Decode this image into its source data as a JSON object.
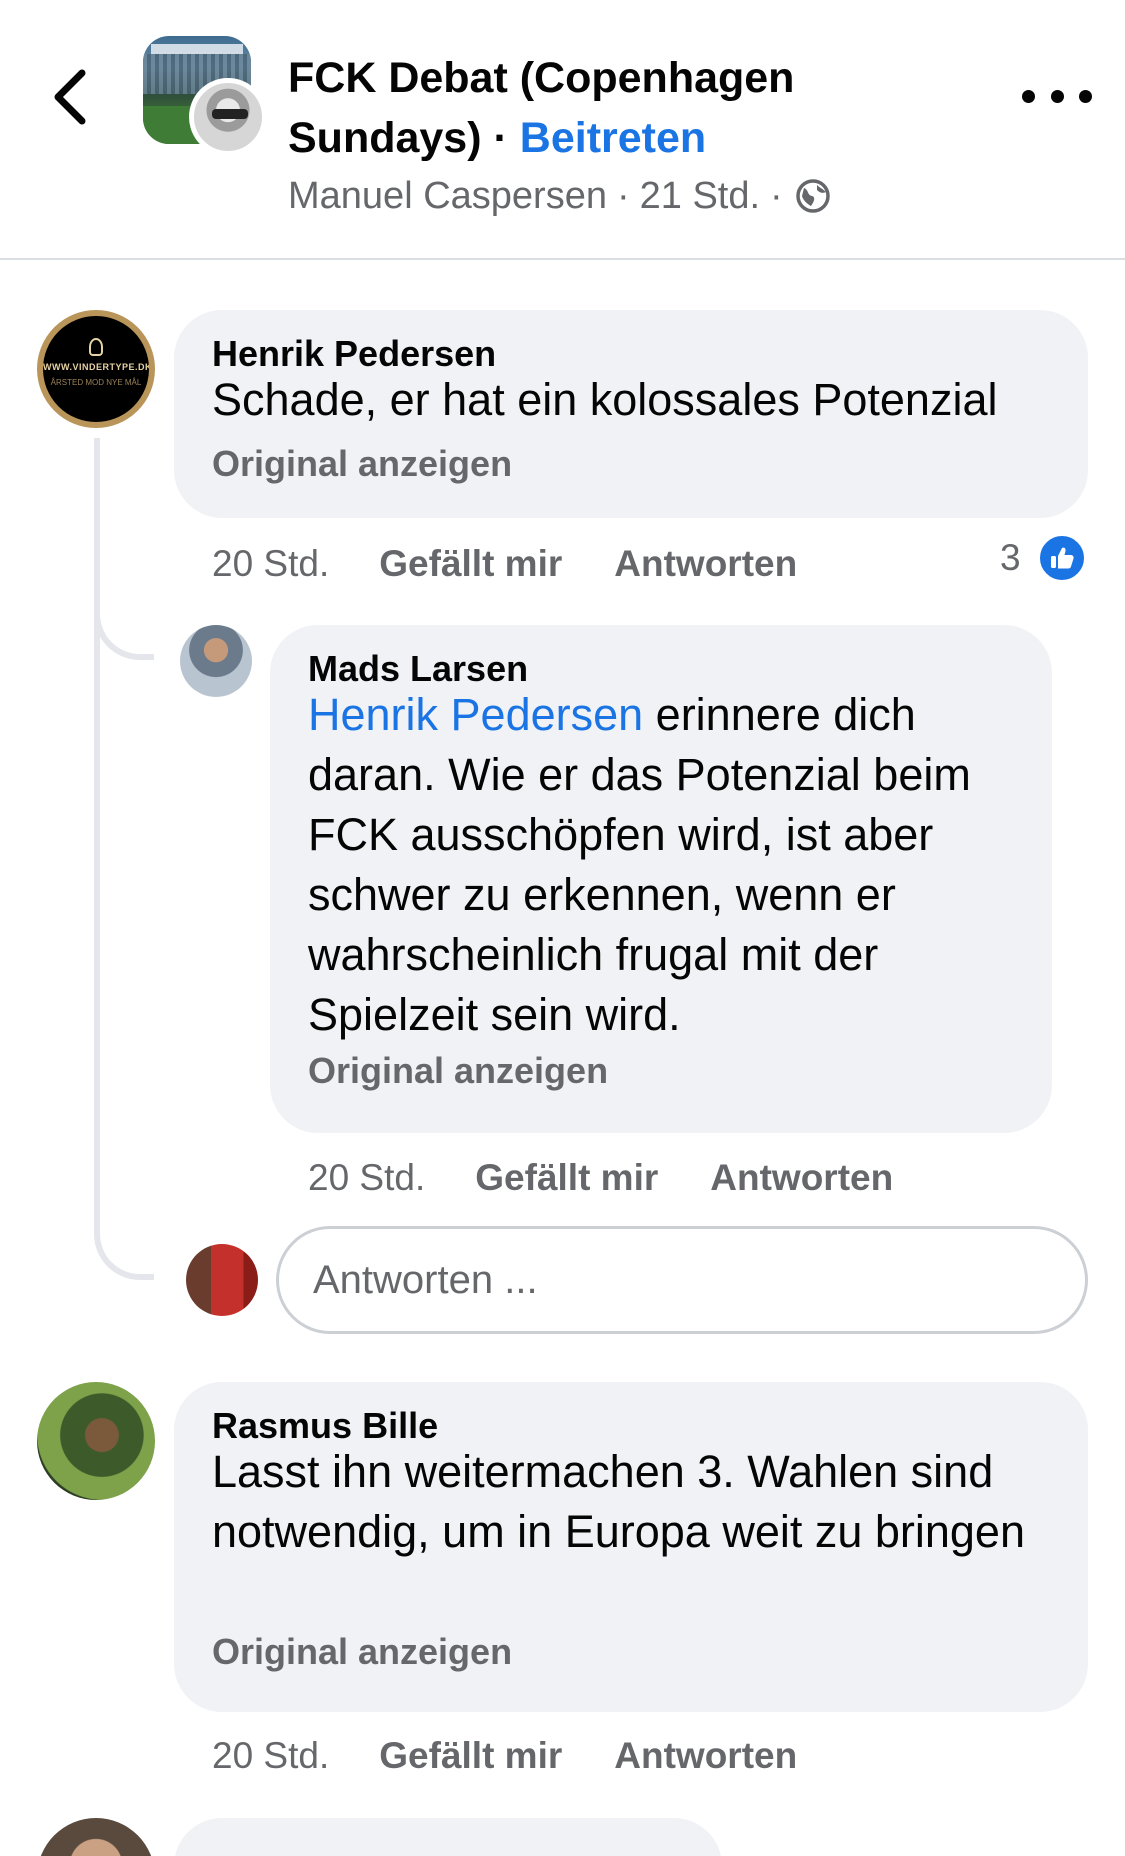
{
  "header": {
    "group_name": "FCK Debat (Copenhagen Sundays)",
    "separator": "·",
    "join_label": "Beitreten",
    "author": "Manuel Caspersen",
    "time": "21 Std.",
    "sub_separator": "·",
    "icons": {
      "back": "chevron-left-icon",
      "more": "more-dots-icon",
      "privacy": "globe-icon"
    }
  },
  "comments": [
    {
      "name": "Henrik Pedersen",
      "text": "Schade, er hat ein kolossales Potenzial",
      "translate": "Original anzeigen",
      "time": "20 Std.",
      "like": "Gefällt mir",
      "reply": "Antworten",
      "reactions": "3",
      "avatar_text": "WWW.VINDERTYPE.DK",
      "avatar_sub": "ÅRSTED MOD NYE MÅL"
    },
    {
      "name": "Mads Larsen",
      "mention": "Henrik Pedersen",
      "text": " erinnere dich daran. Wie er das Potenzial beim FCK ausschöpfen wird, ist aber schwer zu erkennen, wenn er wahrscheinlich frugal mit der Spielzeit sein wird.",
      "translate": "Original anzeigen",
      "time": "20 Std.",
      "like": "Gefällt mir",
      "reply": "Antworten"
    },
    {
      "name": "Rasmus Bille",
      "text": "Lasst ihn weitermachen 3. Wahlen sind notwendig, um in Europa weit zu bringen",
      "translate": "Original anzeigen",
      "time": "20 Std.",
      "like": "Gefällt mir",
      "reply": "Antworten"
    }
  ],
  "reply_input": {
    "placeholder": "Antworten ..."
  },
  "colors": {
    "link": "#1b74e4",
    "secondary_text": "#65676b",
    "bubble": "#f0f2f5",
    "thread_line": "#e4e6eb"
  }
}
